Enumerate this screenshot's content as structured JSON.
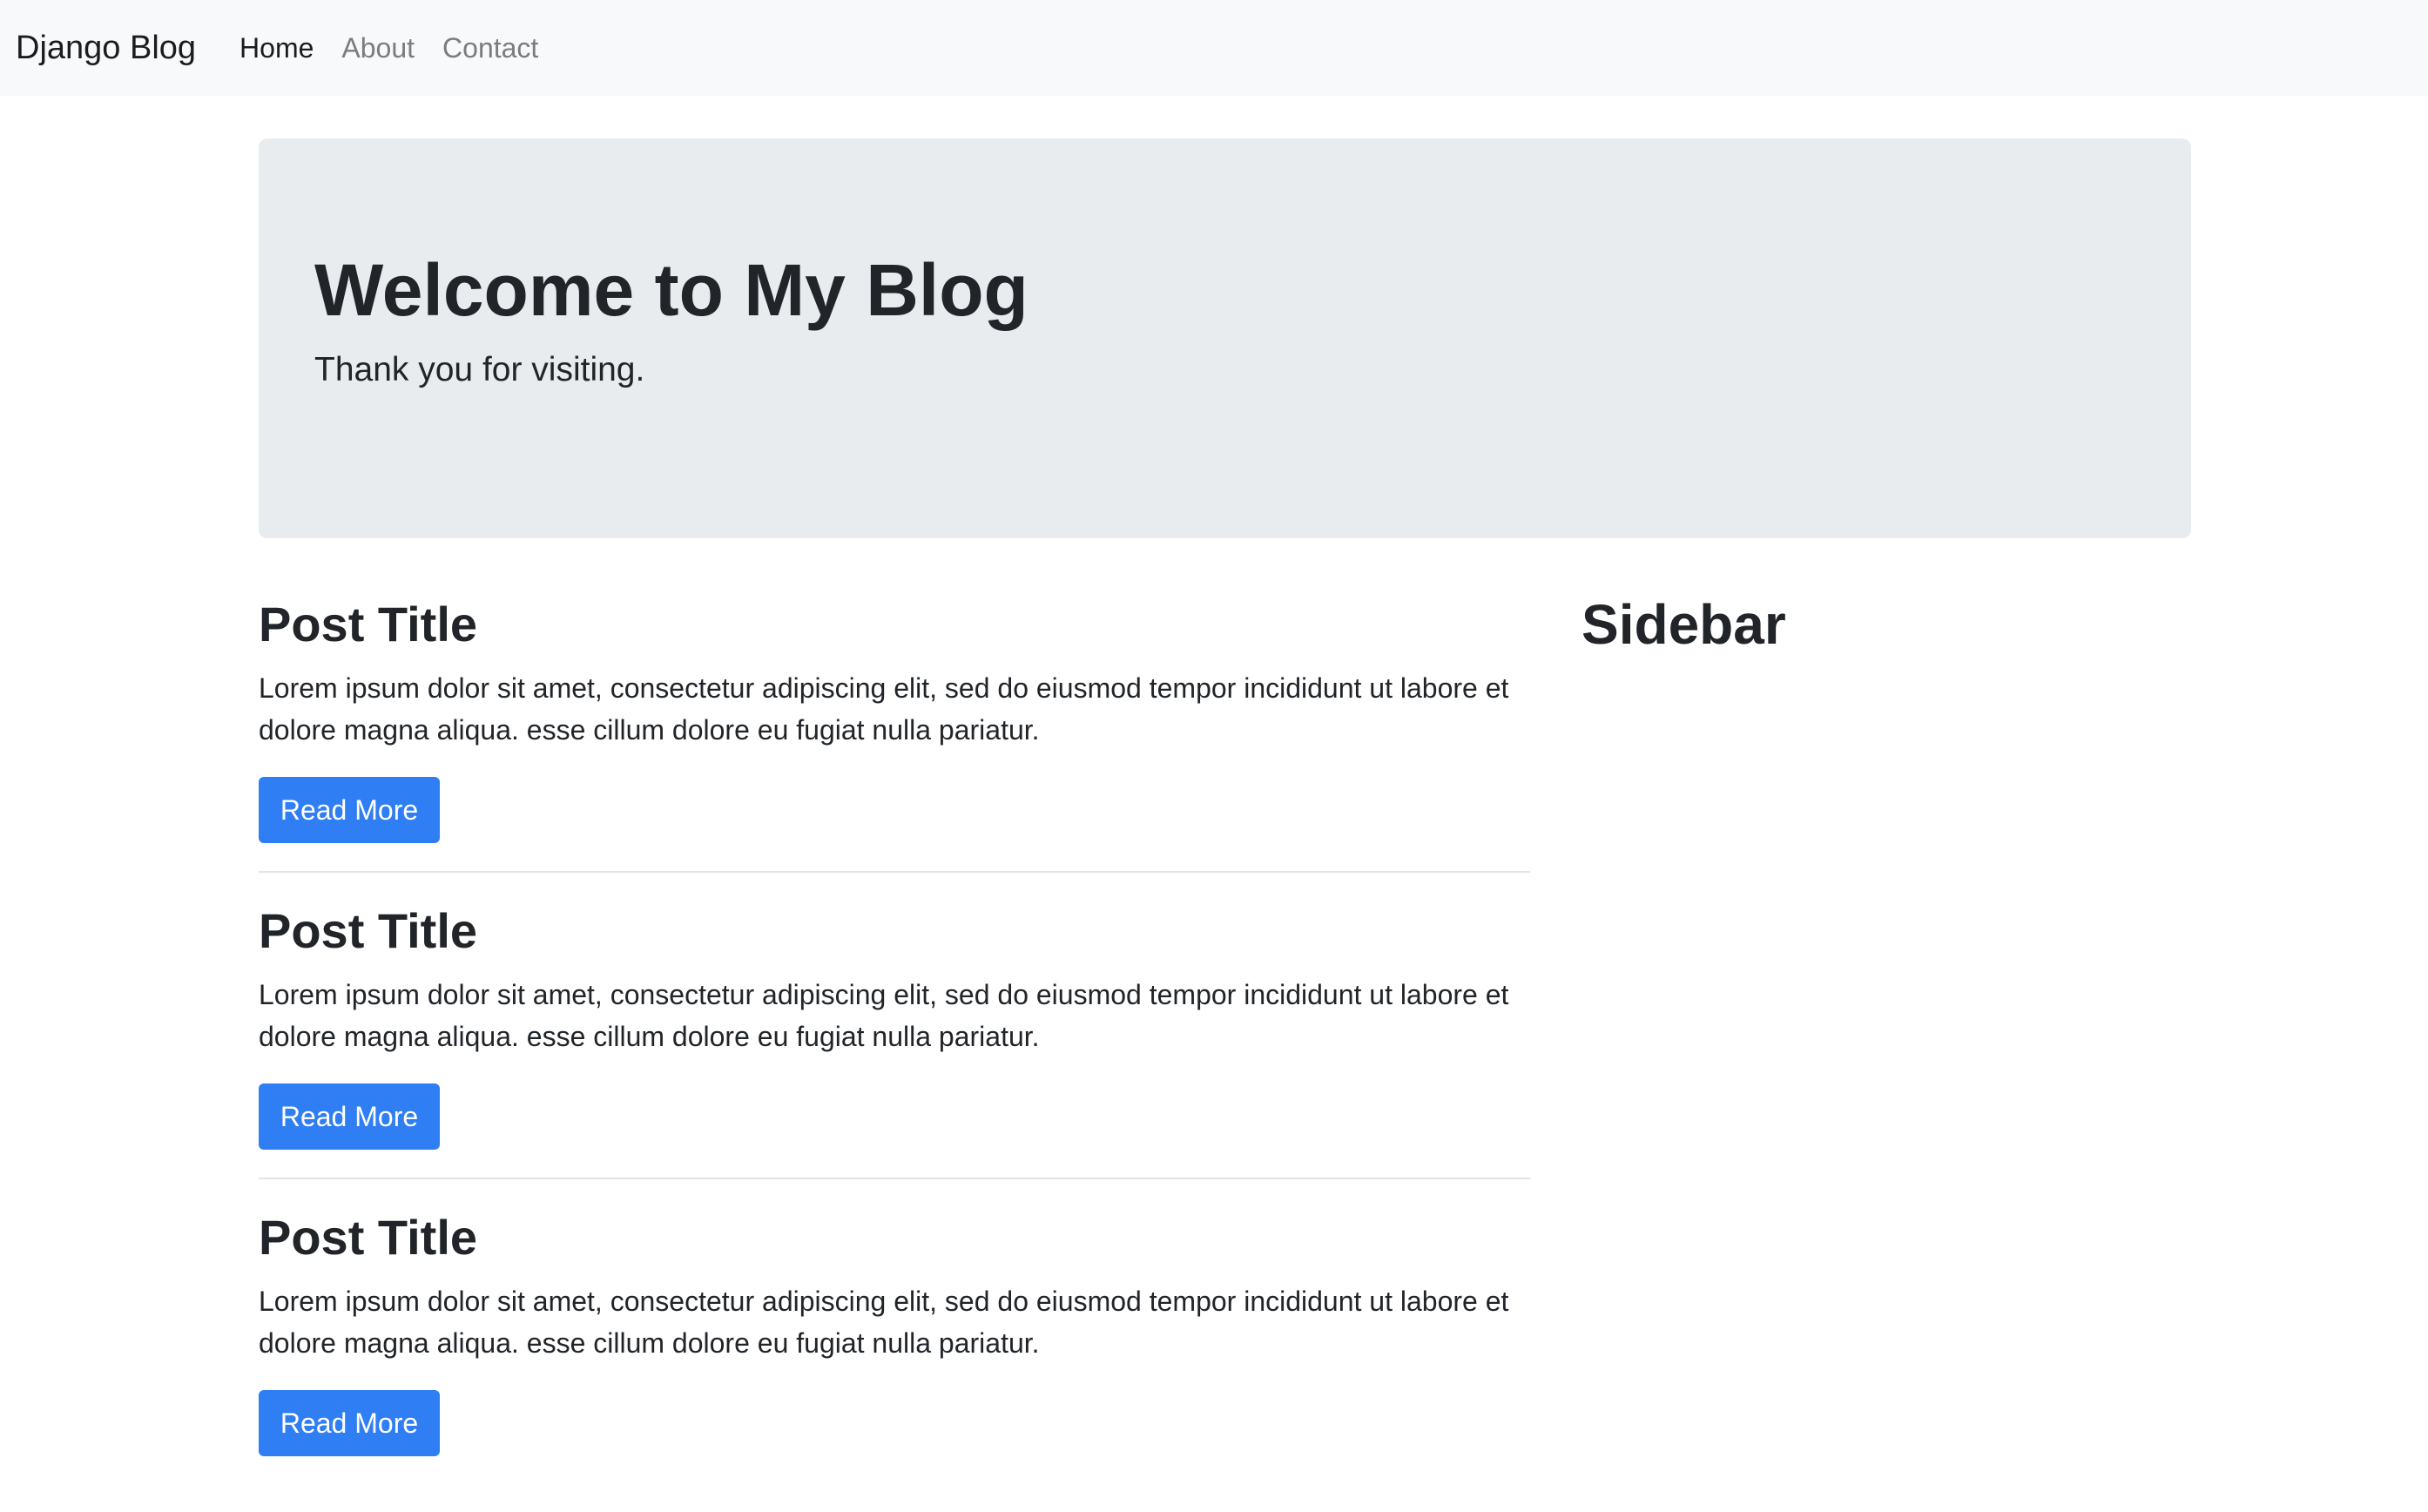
{
  "navbar": {
    "brand": "Django Blog",
    "links": [
      {
        "label": "Home",
        "active": true
      },
      {
        "label": "About",
        "active": false
      },
      {
        "label": "Contact",
        "active": false
      }
    ]
  },
  "jumbotron": {
    "title": "Welcome to My Blog",
    "lead": "Thank you for visiting."
  },
  "posts": [
    {
      "title": "Post Title",
      "text": "Lorem ipsum dolor sit amet, consectetur adipiscing elit, sed do eiusmod tempor incididunt ut labore et dolore magna aliqua. esse cillum dolore eu fugiat nulla pariatur.",
      "button": "Read More"
    },
    {
      "title": "Post Title",
      "text": "Lorem ipsum dolor sit amet, consectetur adipiscing elit, sed do eiusmod tempor incididunt ut labore et dolore magna aliqua. esse cillum dolore eu fugiat nulla pariatur.",
      "button": "Read More"
    },
    {
      "title": "Post Title",
      "text": "Lorem ipsum dolor sit amet, consectetur adipiscing elit, sed do eiusmod tempor incididunt ut labore et dolore magna aliqua. esse cillum dolore eu fugiat nulla pariatur.",
      "button": "Read More"
    }
  ],
  "sidebar": {
    "title": "Sidebar"
  },
  "colors": {
    "navbar_bg": "#f8f9fa",
    "jumbotron_bg": "#e9ecef",
    "primary": "#2f7ef4"
  }
}
